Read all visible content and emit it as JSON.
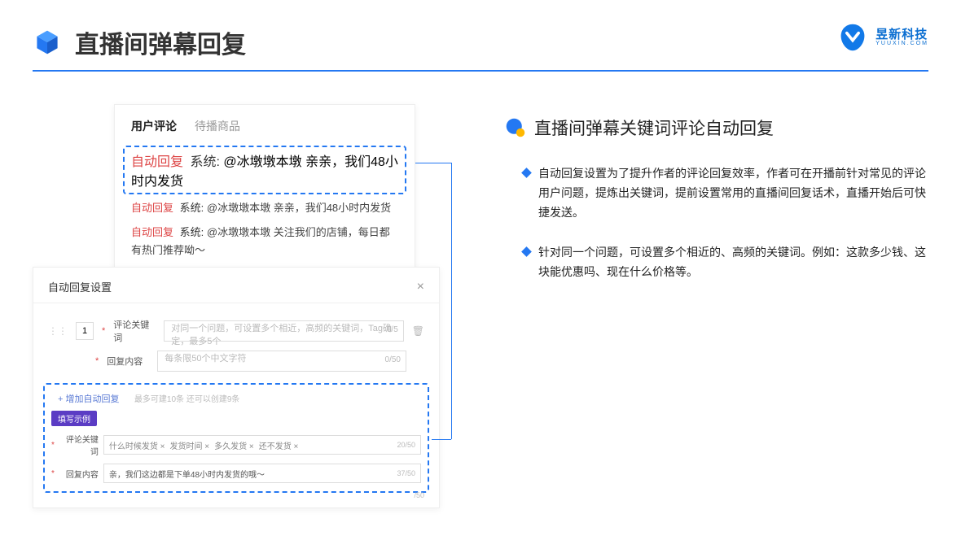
{
  "header": {
    "title": "直播间弹幕回复"
  },
  "brand": {
    "cn": "昱新科技",
    "en": "YUUXIN.COM"
  },
  "comments": {
    "tabs": {
      "active": "用户评论",
      "inactive": "待播商品"
    },
    "line1": {
      "tag": "自动回复",
      "sys": "系统:",
      "text": "@冰墩墩本墩 亲亲，我们48小时内发货"
    },
    "line2": {
      "tag": "自动回复",
      "sys": "系统:",
      "text": "@冰墩墩本墩 亲亲，我们48小时内发货"
    },
    "line3": {
      "tag": "自动回复",
      "sys": "系统:",
      "text": "@冰墩墩本墩 关注我们的店铺，每日都有热门推荐呦～"
    }
  },
  "settings": {
    "title": "自动回复设置",
    "index": "1",
    "kw_label": "评论关键词",
    "kw_ph": "对同一个问题，可设置多个相近，高频的关键词，Tag确定，最多5个",
    "kw_cnt": "0/5",
    "content_label": "回复内容",
    "content_ph": "每条限50个中文字符",
    "content_cnt": "0/50",
    "add": "+ 增加自动回复",
    "add_hint": "最多可建10条 还可以创建9条",
    "example_badge": "填写示例",
    "ex_kw_label": "评论关键词",
    "ex_tags": [
      "什么时候发货 ×",
      "发货时间 ×",
      "多久发货 ×",
      "还不发货 ×"
    ],
    "ex_kw_cnt": "20/50",
    "ex_content_label": "回复内容",
    "ex_content": "亲，我们这边都是下单48小时内发货的哦～",
    "ex_content_cnt": "37/50",
    "stray_cnt": "/50"
  },
  "right": {
    "title": "直播间弹幕关键词评论自动回复",
    "b1": "自动回复设置为了提升作者的评论回复效率，作者可在开播前针对常见的评论用户问题，提炼出关键词，提前设置常用的直播间回复话术，直播开始后可快捷发送。",
    "b2": "针对同一个问题，可设置多个相近的、高频的关键词。例如：这款多少钱、这块能优惠吗、现在什么价格等。"
  }
}
